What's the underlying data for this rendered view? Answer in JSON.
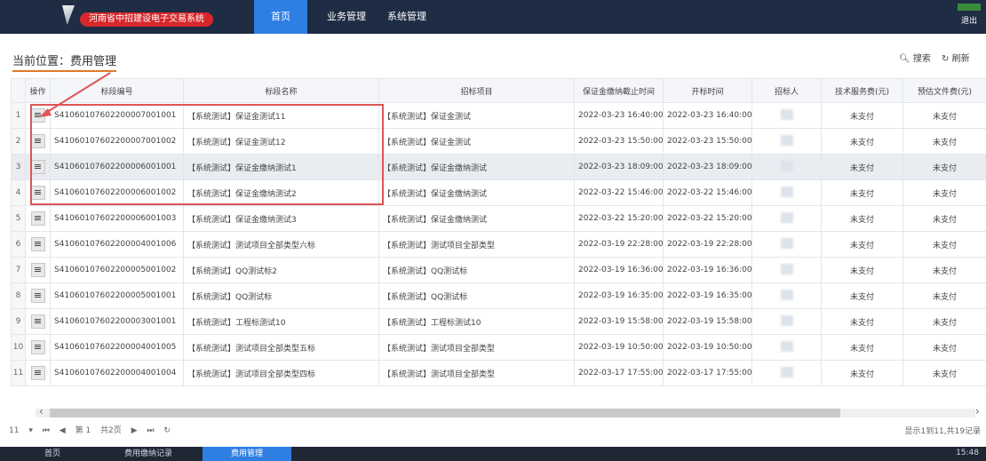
{
  "header": {
    "brand": "河南省中招建设电子交易系统",
    "tabs": [
      {
        "label": "首页",
        "active": true
      },
      {
        "label": "业务管理",
        "active": false
      },
      {
        "label": "系统管理",
        "active": false
      }
    ],
    "user": "退出",
    "accent_color": "#2f7fe3",
    "header_bg": "#1e2c44"
  },
  "breadcrumb": "当前位置：费用管理",
  "toolbar": {
    "search_label": "搜索",
    "refresh_label": "刷新",
    "search_icon": "search-icon",
    "refresh_icon": "refresh-icon"
  },
  "table": {
    "columns": [
      "操作",
      "标段编号",
      "标段名称",
      "招标项目",
      "保证金缴纳截止时间",
      "开标时间",
      "招标人",
      "技术服务费(元)",
      "预估文件费(元)"
    ],
    "rows": [
      {
        "n": "1",
        "code": "S41060107602200007001001",
        "name": "【系统测试】保证金测试11",
        "project": "【系统测试】保证金测试",
        "deadline": "2022-03-23 16:40:00",
        "open": "2022-03-23 16:40:00",
        "fee1": "未支付",
        "fee2": "未支付"
      },
      {
        "n": "2",
        "code": "S41060107602200007001002",
        "name": "【系统测试】保证金测试12",
        "project": "【系统测试】保证金测试",
        "deadline": "2022-03-23 15:50:00",
        "open": "2022-03-23 15:50:00",
        "fee1": "未支付",
        "fee2": "未支付"
      },
      {
        "n": "3",
        "code": "S41060107602200006001001",
        "name": "【系统测试】保证金缴纳测试1",
        "project": "【系统测试】保证金缴纳测试",
        "deadline": "2022-03-23 18:09:00",
        "open": "2022-03-23 18:09:00",
        "fee1": "未支付",
        "fee2": "未支付"
      },
      {
        "n": "4",
        "code": "S41060107602200006001002",
        "name": "【系统测试】保证金缴纳测试2",
        "project": "【系统测试】保证金缴纳测试",
        "deadline": "2022-03-22 15:46:00",
        "open": "2022-03-22 15:46:00",
        "fee1": "未支付",
        "fee2": "未支付"
      },
      {
        "n": "5",
        "code": "S41060107602200006001003",
        "name": "【系统测试】保证金缴纳测试3",
        "project": "【系统测试】保证金缴纳测试",
        "deadline": "2022-03-22 15:20:00",
        "open": "2022-03-22 15:20:00",
        "fee1": "未支付",
        "fee2": "未支付"
      },
      {
        "n": "6",
        "code": "S41060107602200004001006",
        "name": "【系统测试】测试项目全部类型六标",
        "project": "【系统测试】测试项目全部类型",
        "deadline": "2022-03-19 22:28:00",
        "open": "2022-03-19 22:28:00",
        "fee1": "未支付",
        "fee2": "未支付"
      },
      {
        "n": "7",
        "code": "S41060107602200005001002",
        "name": "【系统测试】QQ测试标2",
        "project": "【系统测试】QQ测试标",
        "deadline": "2022-03-19 16:36:00",
        "open": "2022-03-19 16:36:00",
        "fee1": "未支付",
        "fee2": "未支付"
      },
      {
        "n": "8",
        "code": "S41060107602200005001001",
        "name": "【系统测试】QQ测试标",
        "project": "【系统测试】QQ测试标",
        "deadline": "2022-03-19 16:35:00",
        "open": "2022-03-19 16:35:00",
        "fee1": "未支付",
        "fee2": "未支付"
      },
      {
        "n": "9",
        "code": "S41060107602200003001001",
        "name": "【系统测试】工程标测试10",
        "project": "【系统测试】工程标测试10",
        "deadline": "2022-03-19 15:58:00",
        "open": "2022-03-19 15:58:00",
        "fee1": "未支付",
        "fee2": "未支付"
      },
      {
        "n": "10",
        "code": "S41060107602200004001005",
        "name": "【系统测试】测试项目全部类型五标",
        "project": "【系统测试】测试项目全部类型",
        "deadline": "2022-03-19 10:50:00",
        "open": "2022-03-19 10:50:00",
        "fee1": "未支付",
        "fee2": "未支付"
      },
      {
        "n": "11",
        "code": "S41060107602200004001004",
        "name": "【系统测试】测试项目全部类型四标",
        "project": "【系统测试】测试项目全部类型",
        "deadline": "2022-03-17 17:55:00",
        "open": "2022-03-17 17:55:00",
        "fee1": "未支付",
        "fee2": "未支付"
      }
    ]
  },
  "pager": {
    "page_size": "11",
    "page_label": "第 1",
    "page_total": "共2页",
    "info": "显示1到11,共19记录"
  },
  "taskbar": {
    "items": [
      {
        "label": "首页",
        "active": false
      },
      {
        "label": "费用缴纳记录",
        "active": false
      },
      {
        "label": "费用管理",
        "active": true
      }
    ],
    "clock": "15:48"
  },
  "annotation_color": "#e05555"
}
